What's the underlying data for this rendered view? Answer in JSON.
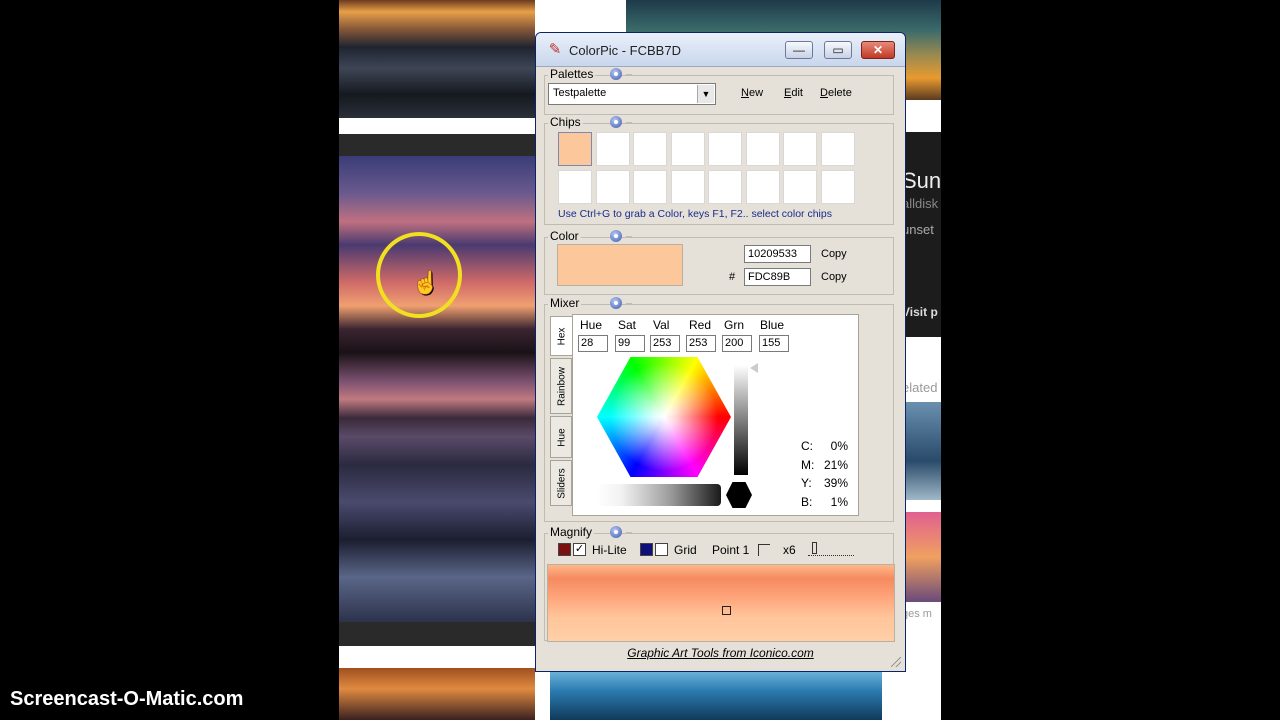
{
  "background_page": {
    "heading": "Suns",
    "subtitle": "alldisk",
    "snippet": "unset",
    "visit_button": "Visit p",
    "related_label": "elated",
    "images_label": "ges m"
  },
  "watermark": "Screencast-O-Matic.com",
  "window": {
    "title": "ColorPic - FCBB7D",
    "icon": "eyedropper-icon",
    "minimize": "—",
    "maximize": "▭",
    "close": "✕"
  },
  "palettes": {
    "label": "Palettes",
    "selected": "Testpalette",
    "new_label": "New",
    "edit_label": "Edit",
    "delete_label": "Delete"
  },
  "chips": {
    "label": "Chips",
    "colors": [
      "#FCC89B",
      "#FFFFFF",
      "#FFFFFF",
      "#FFFFFF",
      "#FFFFFF",
      "#FFFFFF",
      "#FFFFFF",
      "#FFFFFF",
      "#FFFFFF",
      "#FFFFFF",
      "#FFFFFF",
      "#FFFFFF",
      "#FFFFFF",
      "#FFFFFF",
      "#FFFFFF",
      "#FFFFFF"
    ],
    "hint": "Use Ctrl+G to grab a Color, keys F1, F2.. select color chips"
  },
  "color": {
    "label": "Color",
    "swatch": "#FCC89B",
    "decimal": "10209533",
    "hash": "#",
    "hex": "FDC89B",
    "copy_label": "Copy"
  },
  "mixer": {
    "label": "Mixer",
    "tabs": [
      "Hex",
      "Rainbow",
      "Hue",
      "Sliders"
    ],
    "fields": [
      {
        "label": "Hue",
        "value": "28"
      },
      {
        "label": "Sat",
        "value": "99"
      },
      {
        "label": "Val",
        "value": "253"
      },
      {
        "label": "Red",
        "value": "253"
      },
      {
        "label": "Grn",
        "value": "200"
      },
      {
        "label": "Blue",
        "value": "155"
      }
    ],
    "cmyk": [
      {
        "label": "C:",
        "value": "0%"
      },
      {
        "label": "M:",
        "value": "21%"
      },
      {
        "label": "Y:",
        "value": "39%"
      },
      {
        "label": "B:",
        "value": "1%"
      }
    ]
  },
  "magnify": {
    "label": "Magnify",
    "hilite_label": "Hi-Lite",
    "hilite_color": "#7A1010",
    "hilite_checked": "✓",
    "grid_label": "Grid",
    "grid_color": "#10107A",
    "point_label": "Point 1",
    "zoom_label": "x6"
  },
  "footer": "Graphic Art Tools from Iconico.com"
}
